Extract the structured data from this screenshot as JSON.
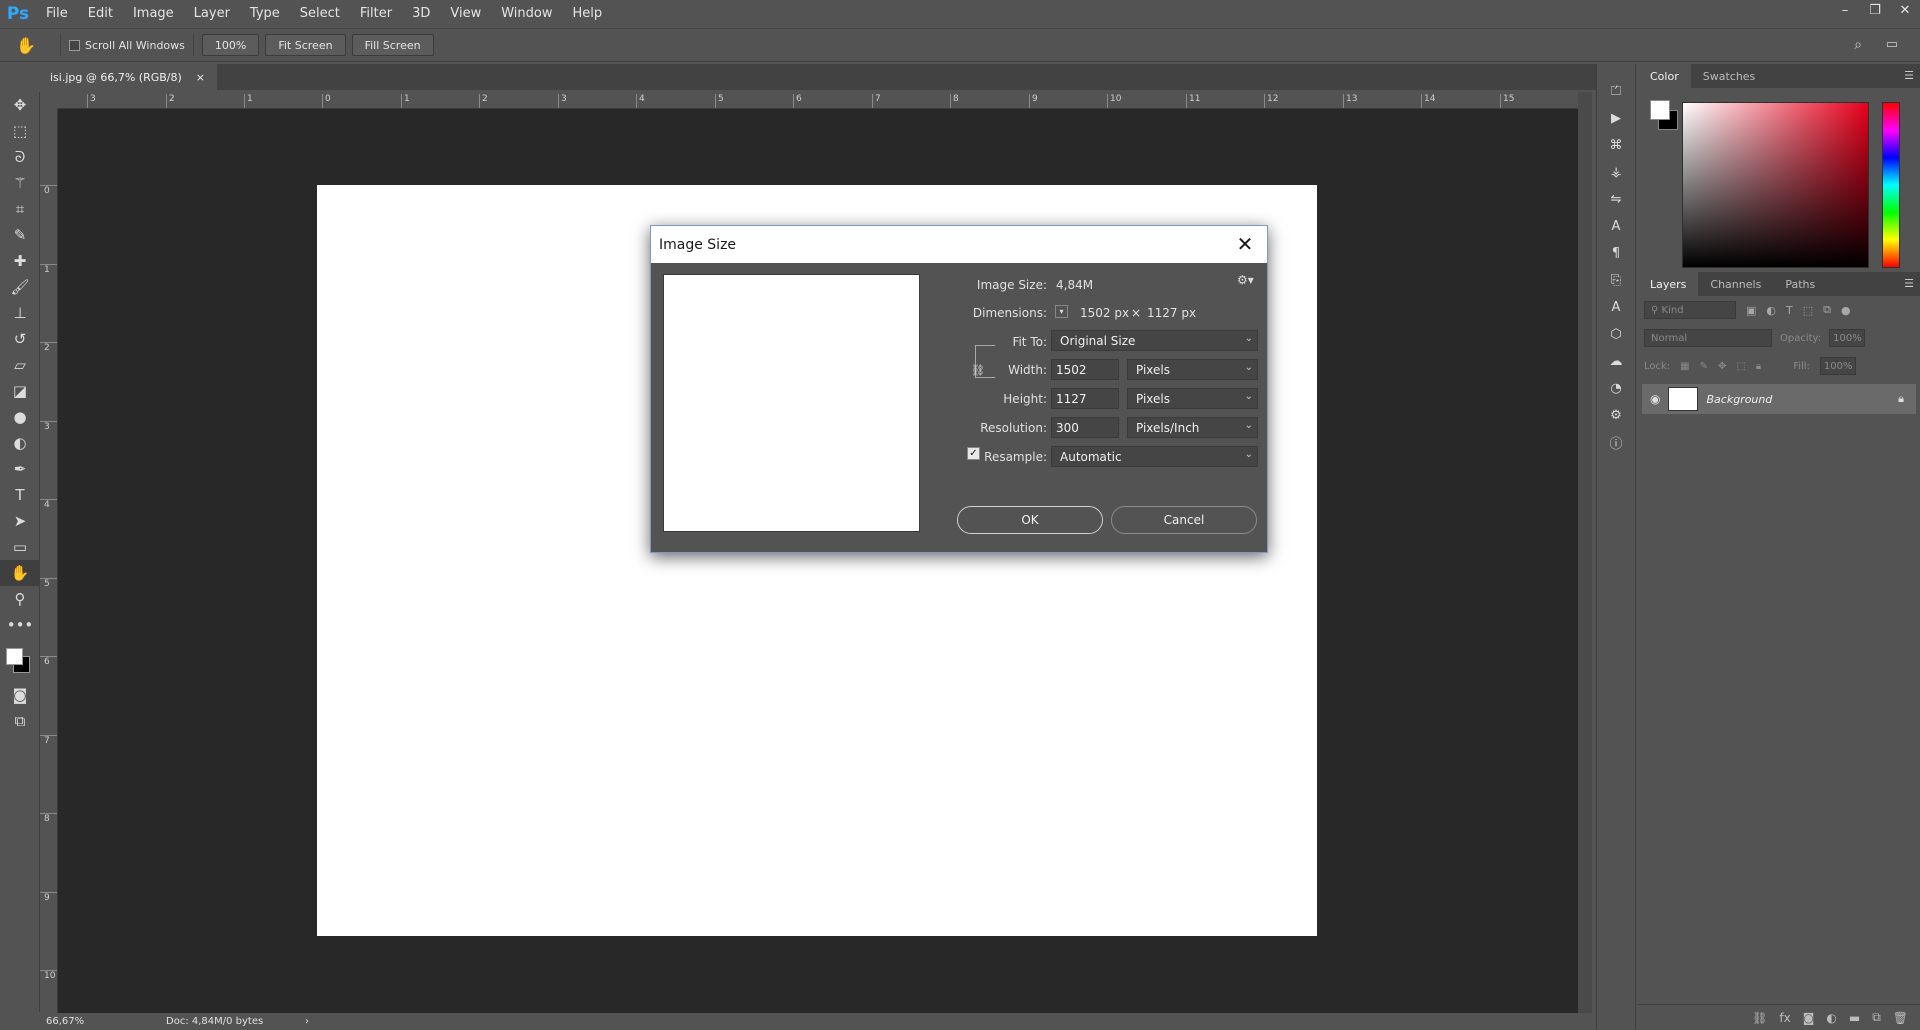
{
  "app": {
    "logo": "Ps",
    "menu": [
      "File",
      "Edit",
      "Image",
      "Layer",
      "Type",
      "Select",
      "Filter",
      "3D",
      "View",
      "Window",
      "Help"
    ]
  },
  "options_bar": {
    "scroll_all_windows": "Scroll All Windows",
    "zoom": "100%",
    "fit_screen": "Fit Screen",
    "fill_screen": "Fill Screen"
  },
  "document_tab": {
    "title": "isi.jpg @ 66,7% (RGB/8)",
    "close": "×"
  },
  "ruler_h": [
    "3",
    "2",
    "1",
    "0",
    "1",
    "2",
    "3",
    "4",
    "5",
    "6",
    "7",
    "8",
    "9",
    "10",
    "11",
    "12",
    "13",
    "14",
    "15"
  ],
  "ruler_v": [
    "0",
    "1",
    "2",
    "3",
    "4",
    "5",
    "6",
    "7",
    "8",
    "9",
    "10"
  ],
  "status": {
    "zoom": "66,67%",
    "doc": "Doc: 4,84M/0 bytes",
    "arrow": "›"
  },
  "color_panel": {
    "tabs": [
      "Color",
      "Swatches"
    ],
    "foreground": "#ffffff",
    "background": "#000000"
  },
  "layers_panel": {
    "tabs": [
      "Layers",
      "Channels",
      "Paths"
    ],
    "filter_placeholder": "Kind",
    "blend_mode": "Normal",
    "opacity_label": "Opacity:",
    "opacity_value": "100%",
    "lock_label": "Lock:",
    "fill_label": "Fill:",
    "fill_value": "100%",
    "layer_name": "Background"
  },
  "dialog": {
    "title": "Image Size",
    "image_size_label": "Image Size:",
    "image_size_value": "4,84M",
    "dimensions_label": "Dimensions:",
    "dim_width": "1502 px",
    "dim_times": "×",
    "dim_height": "1127 px",
    "fit_to_label": "Fit To:",
    "fit_to_value": "Original Size",
    "width_label": "Width:",
    "width_value": "1502",
    "width_unit": "Pixels",
    "height_label": "Height:",
    "height_value": "1127",
    "height_unit": "Pixels",
    "resolution_label": "Resolution:",
    "resolution_value": "300",
    "resolution_unit": "Pixels/Inch",
    "resample_label": "Resample:",
    "resample_value": "Automatic",
    "ok": "OK",
    "cancel": "Cancel"
  }
}
